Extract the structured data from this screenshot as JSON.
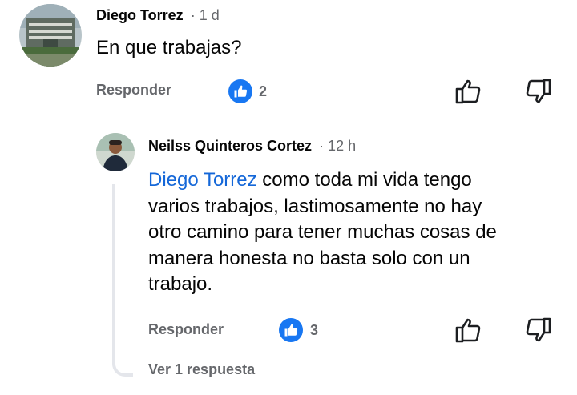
{
  "comment1": {
    "author": "Diego Torrez",
    "time": "· 1 d",
    "text": "En que trabajas?",
    "reply_label": "Responder",
    "like_count": "2"
  },
  "comment2": {
    "author": "Neilss Quinteros Cortez",
    "time": "· 12 h",
    "mention": "Diego Torrez",
    "text_lines": [
      "como toda mi vida tengo",
      "varios trabajos, lastimosamente no hay",
      "otro camino para tener muchas cosas de",
      "manera honesta no basta solo con un",
      "trabajo."
    ],
    "reply_label": "Responder",
    "like_count": "3"
  },
  "view_replies_label": "Ver 1 respuesta",
  "colors": {
    "like_blue": "#1877f2",
    "mention_blue": "#1467d8",
    "meta_gray": "#65676b"
  },
  "icons": {
    "like": "thumbs-up-icon",
    "dislike": "thumbs-down-icon"
  }
}
